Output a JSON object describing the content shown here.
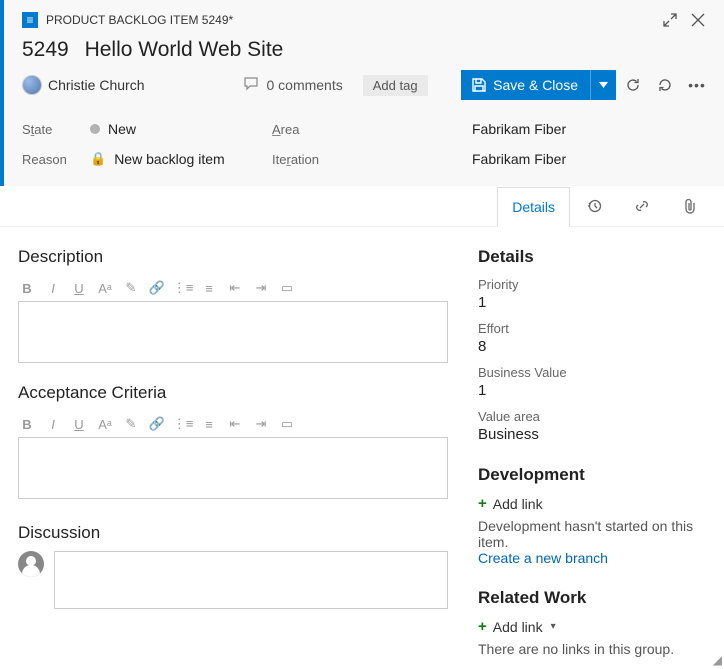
{
  "window": {
    "doc_title": "PRODUCT BACKLOG ITEM 5249*"
  },
  "item": {
    "id": "5249",
    "title": "Hello World Web Site",
    "assignee": "Christie Church",
    "comments_label": "0 comments",
    "add_tag": "Add tag"
  },
  "actions": {
    "save_close": "Save & Close"
  },
  "fields": {
    "state": {
      "label_pre": "S",
      "label_ul": "t",
      "label_post": "ate",
      "value": "New"
    },
    "reason": {
      "label": "Reason",
      "value": "New backlog item"
    },
    "area": {
      "label_ul": "A",
      "label_post": "rea",
      "value": "Fabrikam Fiber"
    },
    "iteration": {
      "label": "Ite",
      "label_ul": "r",
      "label_post": "ation",
      "value": "Fabrikam Fiber"
    }
  },
  "tabs": {
    "details": "Details"
  },
  "left": {
    "description_h": "Description",
    "acceptance_h": "Acceptance Criteria",
    "discussion_h": "Discussion"
  },
  "right": {
    "details_h": "Details",
    "priority_k": "Priority",
    "priority_v": "1",
    "effort_k": "Effort",
    "effort_v": "8",
    "bv_k": "Business Value",
    "bv_v": "1",
    "va_k": "Value area",
    "va_v": "Business",
    "dev_h": "Development",
    "add_link": "Add link",
    "dev_msg": "Development hasn't started on this item.",
    "dev_link": "Create a new branch",
    "rel_h": "Related Work",
    "rel_msg": "There are no links in this group."
  }
}
